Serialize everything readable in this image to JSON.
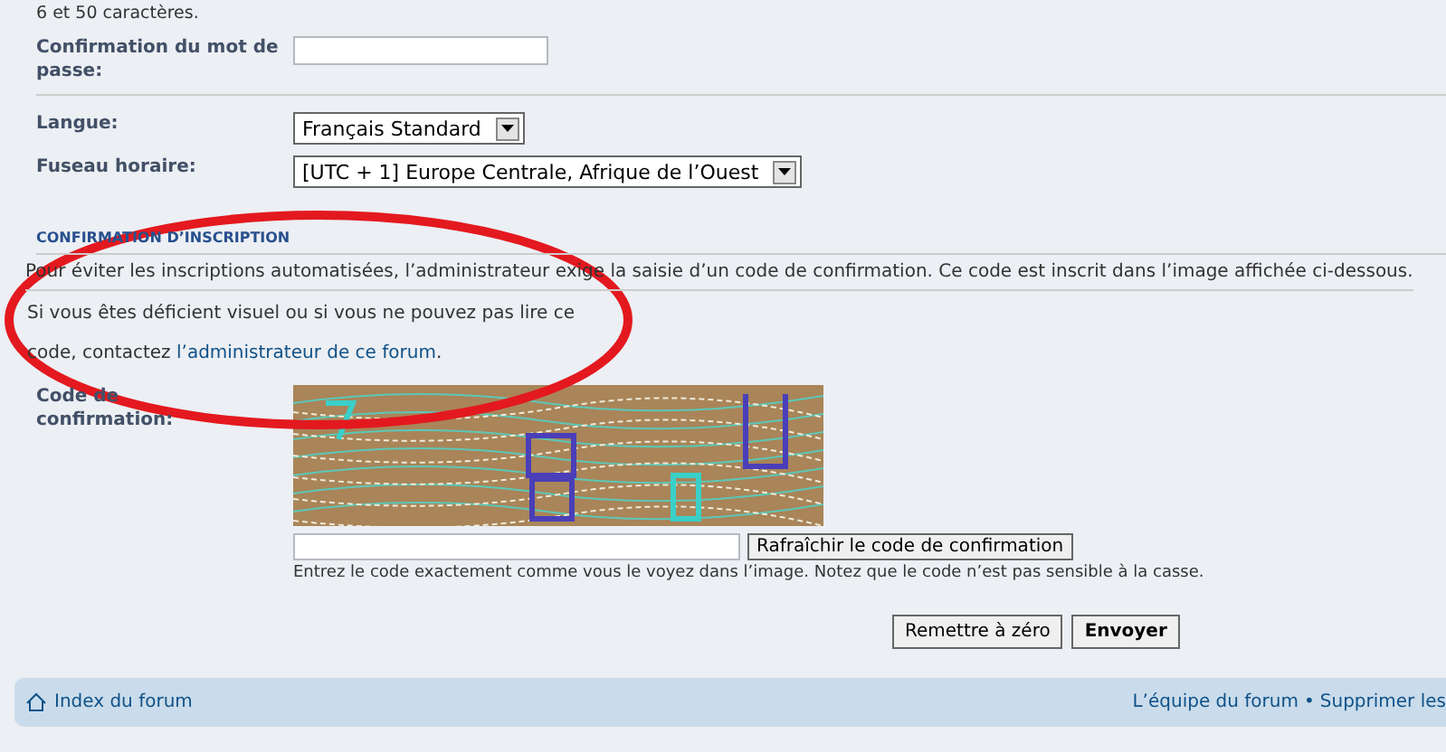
{
  "intro_hint": "6 et 50 caractères.",
  "fields": [
    {
      "kind": "text",
      "label": "Confirmation du mot de passe:"
    },
    {
      "kind": "select",
      "label": "Langue:",
      "value": "Français Standard"
    },
    {
      "kind": "select",
      "label": "Fuseau horaire:",
      "value": "[UTC + 1] Europe Centrale, Afrique de l’Ouest"
    }
  ],
  "confirmation": {
    "heading": "CONFIRMATION D’INSCRIPTION",
    "explanation": "Pour éviter les inscriptions automatisées, l’administrateur exige la saisie d’un code de confirmation. Ce code est inscrit dans l’image affichée ci-dessous.",
    "help_text": "Si vous êtes déficient visuel ou si vous ne pouvez pas lire ce code, contactez",
    "help_link": "l’administrateur de ce forum",
    "help_end": ".",
    "code_label": "Code de confirmation:",
    "refresh_button": "Rafraîchir le code de confirmation",
    "code_hint": "Entrez le code exactement comme vous le voyez dans l’image. Notez que le code n’est pas sensible à la casse."
  },
  "buttons": [
    {
      "label": "Remettre à zéro",
      "primary": false
    },
    {
      "label": "Envoyer",
      "primary": true
    }
  ],
  "footer": {
    "left": "Index du forum",
    "right": [
      "L’équipe du forum",
      "Supprimer les"
    ],
    "separator": "•"
  }
}
